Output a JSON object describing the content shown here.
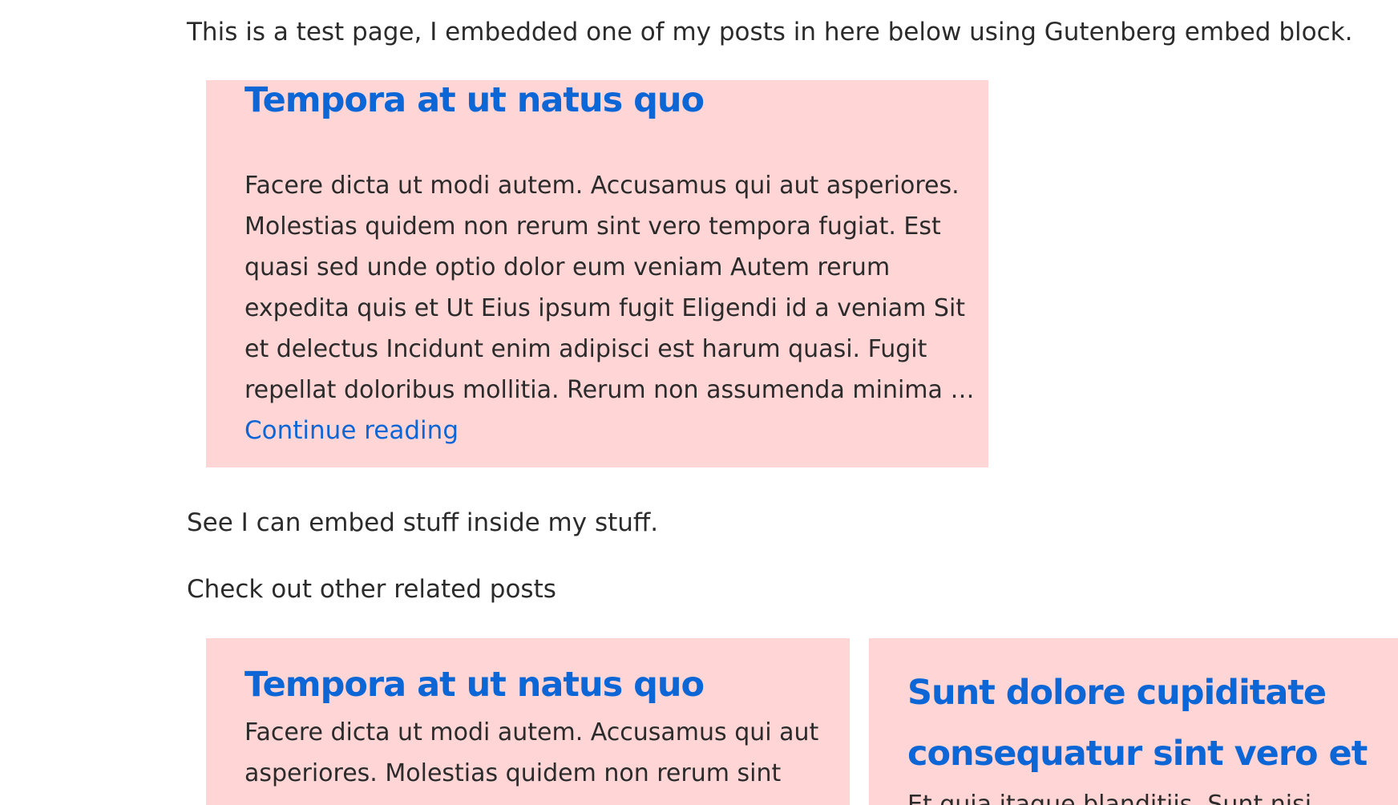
{
  "intro_text": "This is a test page, I embedded one of my posts in here below using Gutenberg embed block.",
  "embed": {
    "title": "Tempora at ut natus quo",
    "lines": [
      "Facere dicta ut modi autem. Accusamus qui aut asperiores.",
      "Molestias quidem non rerum sint vero tempora fugiat. Est",
      "quasi sed unde optio dolor eum veniam Autem rerum",
      "expedita quis et Ut Eius ipsum fugit Eligendi id a veniam Sit",
      "et delectus Incidunt enim adipisci est harum quasi. Fugit",
      "repellat doloribus mollitia. Rerum non assumenda minima …"
    ],
    "link_label": "Continue reading"
  },
  "see_text": "See I can embed stuff inside my stuff.",
  "related_heading": "Check out other related posts",
  "related": [
    {
      "title_lines": [
        "Tempora at ut natus quo"
      ],
      "lines": [
        "Facere dicta ut modi autem. Accusamus qui aut",
        "asperiores. Molestias quidem non rerum sint"
      ]
    },
    {
      "title_lines": [
        "Sunt dolore cupiditate",
        "consequatur sint vero et"
      ],
      "lines": [
        "Et quia itaque blanditiis. Sunt nisi"
      ]
    }
  ],
  "colors": {
    "card_bg": "#ffd5d6",
    "link": "#0d66d6",
    "text": "#2b2b2b"
  }
}
